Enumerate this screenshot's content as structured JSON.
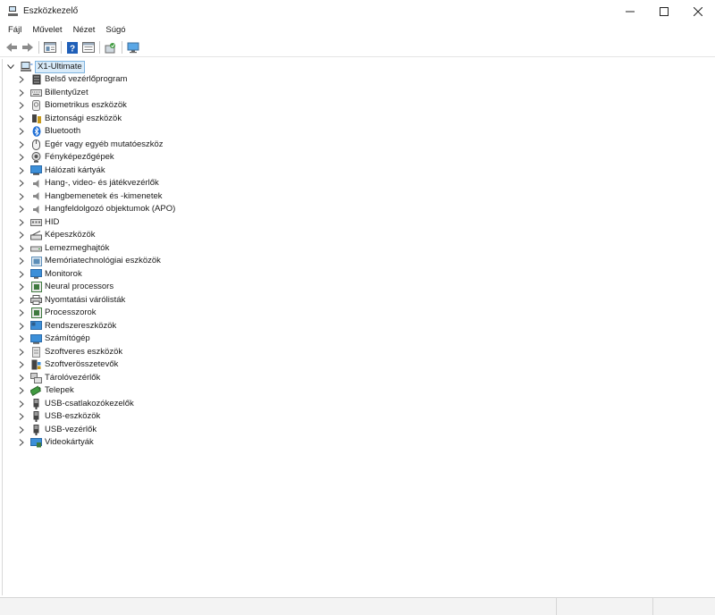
{
  "window": {
    "title": "Eszközkezelő",
    "app_icon": "device-manager-icon",
    "controls": [
      "minimize-icon",
      "maximize-icon",
      "close-icon"
    ]
  },
  "menu": {
    "items": [
      {
        "label": "Fájl"
      },
      {
        "label": "Művelet"
      },
      {
        "label": "Nézet"
      },
      {
        "label": "Súgó"
      }
    ]
  },
  "toolbar": {
    "buttons": [
      "back-icon",
      "forward-icon",
      "properties-view-icon",
      "help-icon",
      "properties-icon",
      "scan-hardware-icon",
      "monitor-icon"
    ]
  },
  "tree": {
    "root": {
      "label": "X1-Ultimate",
      "icon": "computer-icon",
      "expanded": true
    },
    "categories": [
      {
        "label": "Belső vezérlőprogram",
        "icon": "firmware-icon",
        "color": "#3a3a3a"
      },
      {
        "label": "Billentyűzet",
        "icon": "keyboard-icon",
        "color": "#6b6b6b"
      },
      {
        "label": "Biometrikus eszközök",
        "icon": "biometric-icon",
        "color": "#7a7a7a"
      },
      {
        "label": "Biztonsági eszközök",
        "icon": "security-key-icon",
        "color": "#c99a1a"
      },
      {
        "label": "Bluetooth",
        "icon": "bluetooth-icon",
        "color": "#1f6fd6"
      },
      {
        "label": "Egér vagy egyéb mutatóeszköz",
        "icon": "mouse-icon",
        "color": "#555555"
      },
      {
        "label": "Fényképezőgépek",
        "icon": "camera-icon",
        "color": "#555555"
      },
      {
        "label": "Hálózati kártyák",
        "icon": "network-adapter-icon",
        "color": "#3c8fd8"
      },
      {
        "label": "Hang-, video- és játékvezérlők",
        "icon": "speaker-icon",
        "color": "#8a8a8a"
      },
      {
        "label": "Hangbemenetek és -kimenetek",
        "icon": "speaker-icon",
        "color": "#8a8a8a"
      },
      {
        "label": "Hangfeldolgozó objektumok (APO)",
        "icon": "speaker-icon",
        "color": "#8a8a8a"
      },
      {
        "label": "HID",
        "icon": "hid-icon",
        "color": "#6b6b6b"
      },
      {
        "label": "Képeszközök",
        "icon": "scanner-icon",
        "color": "#555555"
      },
      {
        "label": "Lemezmeghajtók",
        "icon": "disk-drive-icon",
        "color": "#666666"
      },
      {
        "label": "Memóriatechnológiai eszközök",
        "icon": "memory-device-icon",
        "color": "#5b8db8"
      },
      {
        "label": "Monitorok",
        "icon": "monitor-icon",
        "color": "#3c8fd8"
      },
      {
        "label": "Neural processors",
        "icon": "processor-icon",
        "color": "#3f7a3f"
      },
      {
        "label": "Nyomtatási várólisták",
        "icon": "printer-icon",
        "color": "#555555"
      },
      {
        "label": "Processzorok",
        "icon": "processor-icon",
        "color": "#3f7a3f"
      },
      {
        "label": "Rendszereszközök",
        "icon": "system-devices-icon",
        "color": "#3c8fd8"
      },
      {
        "label": "Számítógép",
        "icon": "computer-icon",
        "color": "#3c8fd8"
      },
      {
        "label": "Szoftveres eszközök",
        "icon": "software-device-icon",
        "color": "#8a8a8a"
      },
      {
        "label": "Szoftverösszetevők",
        "icon": "software-component-icon",
        "color": "#555555"
      },
      {
        "label": "Tárolóvezérlők",
        "icon": "storage-controller-icon",
        "color": "#6b6b6b"
      },
      {
        "label": "Telepek",
        "icon": "battery-icon",
        "color": "#3f9a3f"
      },
      {
        "label": "USB-csatlakozókezelők",
        "icon": "usb-icon",
        "color": "#444444"
      },
      {
        "label": "USB-eszközök",
        "icon": "usb-icon",
        "color": "#444444"
      },
      {
        "label": "USB-vezérlők",
        "icon": "usb-icon",
        "color": "#444444"
      },
      {
        "label": "Videokártyák",
        "icon": "display-adapter-icon",
        "color": "#3c8fd8"
      }
    ]
  }
}
